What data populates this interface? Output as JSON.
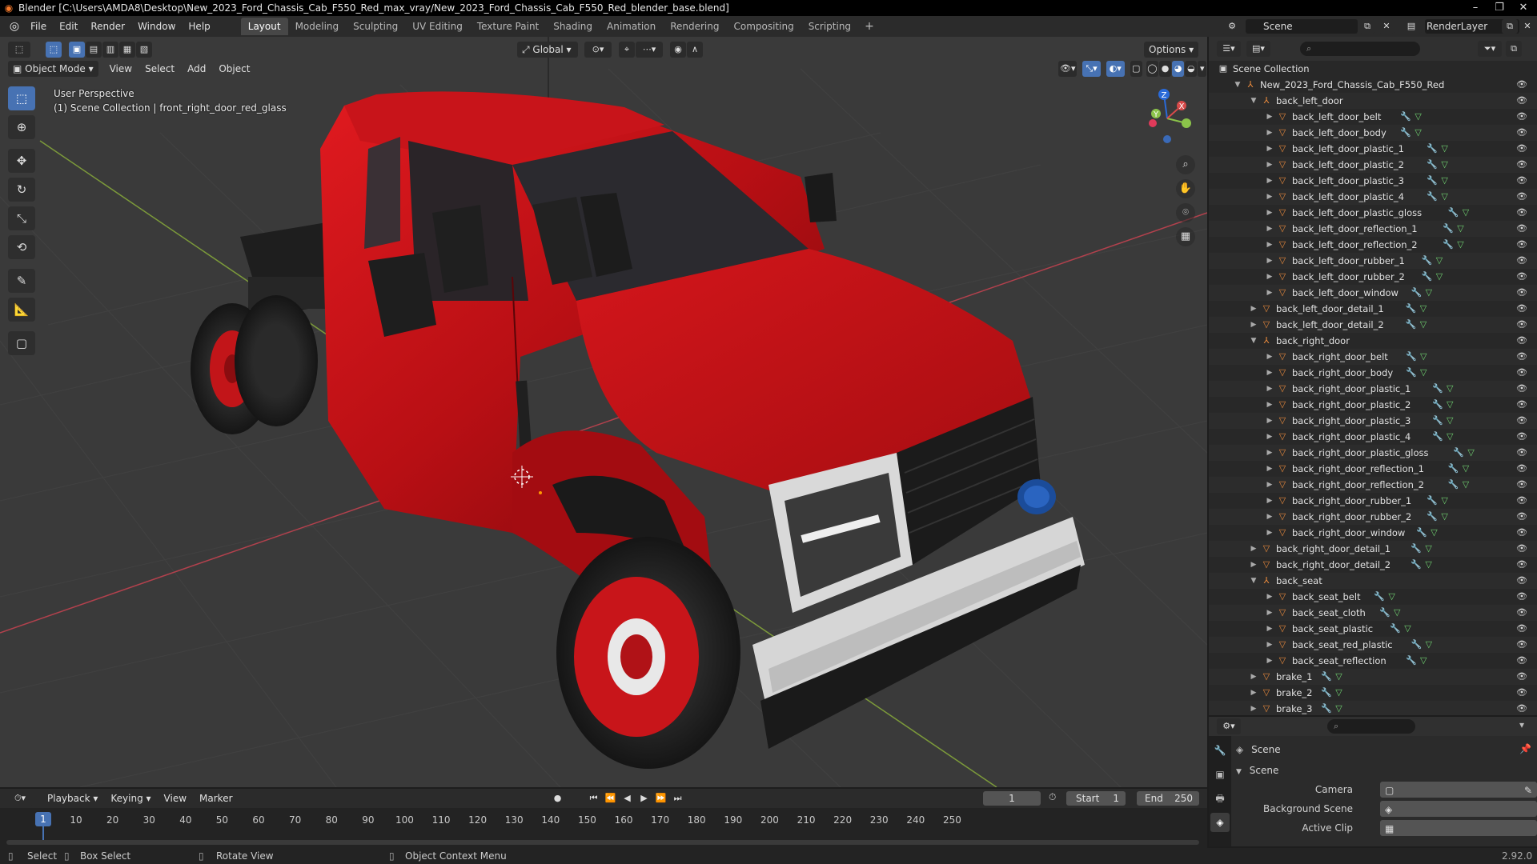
{
  "window": {
    "title": "Blender [C:\\Users\\AMDA8\\Desktop\\New_2023_Ford_Chassis_Cab_F550_Red_max_vray/New_2023_Ford_Chassis_Cab_F550_Red_blender_base.blend]"
  },
  "menu": [
    "File",
    "Edit",
    "Render",
    "Window",
    "Help"
  ],
  "workspaces": [
    "Layout",
    "Modeling",
    "Sculpting",
    "UV Editing",
    "Texture Paint",
    "Shading",
    "Animation",
    "Rendering",
    "Compositing",
    "Scripting"
  ],
  "scene_selector": {
    "scene": "Scene",
    "view_layer": "RenderLayer"
  },
  "viewport": {
    "mode": "Object Mode",
    "menus": [
      "View",
      "Select",
      "Add",
      "Object"
    ],
    "orientation": "Global",
    "options_label": "Options",
    "info_line1": "User Perspective",
    "info_line2": "(1) Scene Collection | front_right_door_red_glass",
    "gizmo_labels": {
      "x": "X",
      "y": "Y",
      "z": "Z"
    },
    "colors": {
      "grid_bg": "#3a3a3a",
      "x_axis": "#b3414d",
      "y_axis": "#7c9a3a",
      "truck_red": "#c8141a"
    }
  },
  "outliner": {
    "root": "Scene Collection",
    "rows": [
      {
        "label": "New_2023_Ford_Chassis_Cab_F550_Red",
        "type": "empty",
        "depth": 1,
        "expanded": true
      },
      {
        "label": "back_left_door",
        "type": "empty",
        "depth": 2,
        "expanded": true
      },
      {
        "label": "back_left_door_belt",
        "type": "mesh",
        "depth": 3
      },
      {
        "label": "back_left_door_body",
        "type": "mesh",
        "depth": 3
      },
      {
        "label": "back_left_door_plastic_1",
        "type": "mesh",
        "depth": 3
      },
      {
        "label": "back_left_door_plastic_2",
        "type": "mesh",
        "depth": 3
      },
      {
        "label": "back_left_door_plastic_3",
        "type": "mesh",
        "depth": 3
      },
      {
        "label": "back_left_door_plastic_4",
        "type": "mesh",
        "depth": 3
      },
      {
        "label": "back_left_door_plastic_gloss",
        "type": "mesh",
        "depth": 3
      },
      {
        "label": "back_left_door_reflection_1",
        "type": "mesh",
        "depth": 3
      },
      {
        "label": "back_left_door_reflection_2",
        "type": "mesh",
        "depth": 3
      },
      {
        "label": "back_left_door_rubber_1",
        "type": "mesh",
        "depth": 3
      },
      {
        "label": "back_left_door_rubber_2",
        "type": "mesh",
        "depth": 3
      },
      {
        "label": "back_left_door_window",
        "type": "mesh",
        "depth": 3
      },
      {
        "label": "back_left_door_detail_1",
        "type": "mesh",
        "depth": 2
      },
      {
        "label": "back_left_door_detail_2",
        "type": "mesh",
        "depth": 2
      },
      {
        "label": "back_right_door",
        "type": "empty",
        "depth": 2,
        "expanded": true
      },
      {
        "label": "back_right_door_belt",
        "type": "mesh",
        "depth": 3
      },
      {
        "label": "back_right_door_body",
        "type": "mesh",
        "depth": 3
      },
      {
        "label": "back_right_door_plastic_1",
        "type": "mesh",
        "depth": 3
      },
      {
        "label": "back_right_door_plastic_2",
        "type": "mesh",
        "depth": 3
      },
      {
        "label": "back_right_door_plastic_3",
        "type": "mesh",
        "depth": 3
      },
      {
        "label": "back_right_door_plastic_4",
        "type": "mesh",
        "depth": 3
      },
      {
        "label": "back_right_door_plastic_gloss",
        "type": "mesh",
        "depth": 3
      },
      {
        "label": "back_right_door_reflection_1",
        "type": "mesh",
        "depth": 3
      },
      {
        "label": "back_right_door_reflection_2",
        "type": "mesh",
        "depth": 3
      },
      {
        "label": "back_right_door_rubber_1",
        "type": "mesh",
        "depth": 3
      },
      {
        "label": "back_right_door_rubber_2",
        "type": "mesh",
        "depth": 3
      },
      {
        "label": "back_right_door_window",
        "type": "mesh",
        "depth": 3
      },
      {
        "label": "back_right_door_detail_1",
        "type": "mesh",
        "depth": 2
      },
      {
        "label": "back_right_door_detail_2",
        "type": "mesh",
        "depth": 2
      },
      {
        "label": "back_seat",
        "type": "empty",
        "depth": 2,
        "expanded": true
      },
      {
        "label": "back_seat_belt",
        "type": "mesh",
        "depth": 3
      },
      {
        "label": "back_seat_cloth",
        "type": "mesh",
        "depth": 3
      },
      {
        "label": "back_seat_plastic",
        "type": "mesh",
        "depth": 3
      },
      {
        "label": "back_seat_red_plastic",
        "type": "mesh",
        "depth": 3
      },
      {
        "label": "back_seat_reflection",
        "type": "mesh",
        "depth": 3
      },
      {
        "label": "brake_1",
        "type": "mesh",
        "depth": 2
      },
      {
        "label": "brake_2",
        "type": "mesh",
        "depth": 2
      },
      {
        "label": "brake_3",
        "type": "mesh",
        "depth": 2
      }
    ]
  },
  "properties": {
    "context": "Scene",
    "panel": "Scene",
    "fields": [
      {
        "label": "Camera"
      },
      {
        "label": "Background Scene"
      },
      {
        "label": "Active Clip"
      }
    ]
  },
  "timeline": {
    "menus": [
      "Playback",
      "Keying",
      "View",
      "Marker"
    ],
    "current_frame": "1",
    "start_label": "Start",
    "start": "1",
    "end_label": "End",
    "end": "250",
    "ticks": [
      "10",
      "20",
      "30",
      "40",
      "50",
      "60",
      "70",
      "80",
      "90",
      "100",
      "110",
      "120",
      "130",
      "140",
      "150",
      "160",
      "170",
      "180",
      "190",
      "200",
      "210",
      "220",
      "230",
      "240",
      "250"
    ],
    "playhead": "1"
  },
  "statusbar": {
    "select": "Select",
    "box_select": "Box Select",
    "rotate_view": "Rotate View",
    "context_menu": "Object Context Menu",
    "version": "2.92.0"
  }
}
